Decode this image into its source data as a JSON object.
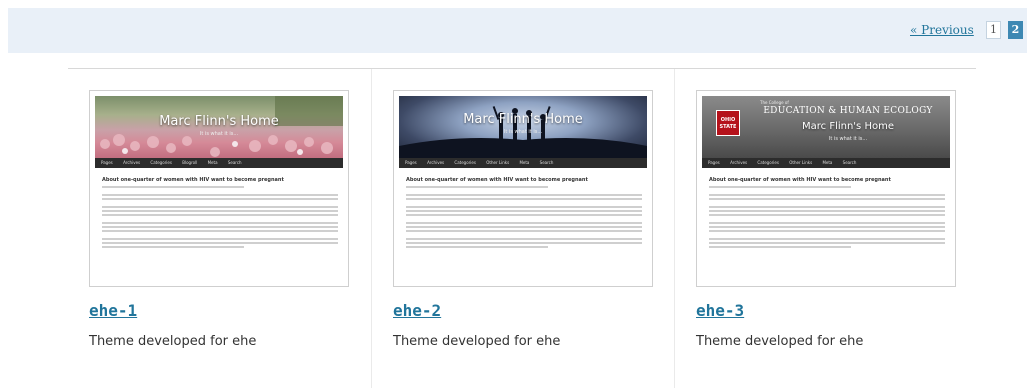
{
  "pagination": {
    "previous_label": "« Previous",
    "pages": [
      "1",
      "2"
    ],
    "current_page": "2"
  },
  "themes": [
    {
      "title": "ehe-1",
      "description": "Theme developed for ehe",
      "preview": {
        "site_title": "Marc Flinn's Home",
        "tagline": "It is what it is...",
        "nav": [
          "Pages",
          "Archives",
          "Categories",
          "Blogroll",
          "Meta",
          "Search"
        ],
        "post_title": "About one-quarter of women with HIV want to become pregnant"
      }
    },
    {
      "title": "ehe-2",
      "description": "Theme developed for ehe",
      "preview": {
        "site_title": "Marc Flinn's Home",
        "tagline": "It is what it is...",
        "nav": [
          "Pages",
          "Archives",
          "Categories",
          "Other Links",
          "Meta",
          "Search"
        ],
        "post_title": "About one-quarter of women with HIV want to become pregnant"
      }
    },
    {
      "title": "ehe-3",
      "description": "Theme developed for ehe",
      "preview": {
        "college_small": "The College of",
        "college_name": "EDUCATION & HUMAN ECOLOGY",
        "logo_text": "OHIO STATE",
        "site_title": "Marc Flinn's Home",
        "tagline": "It is what it is...",
        "nav": [
          "Pages",
          "Archives",
          "Categories",
          "Other Links",
          "Meta",
          "Search"
        ],
        "post_title": "About one-quarter of women with HIV want to become pregnant"
      }
    }
  ]
}
